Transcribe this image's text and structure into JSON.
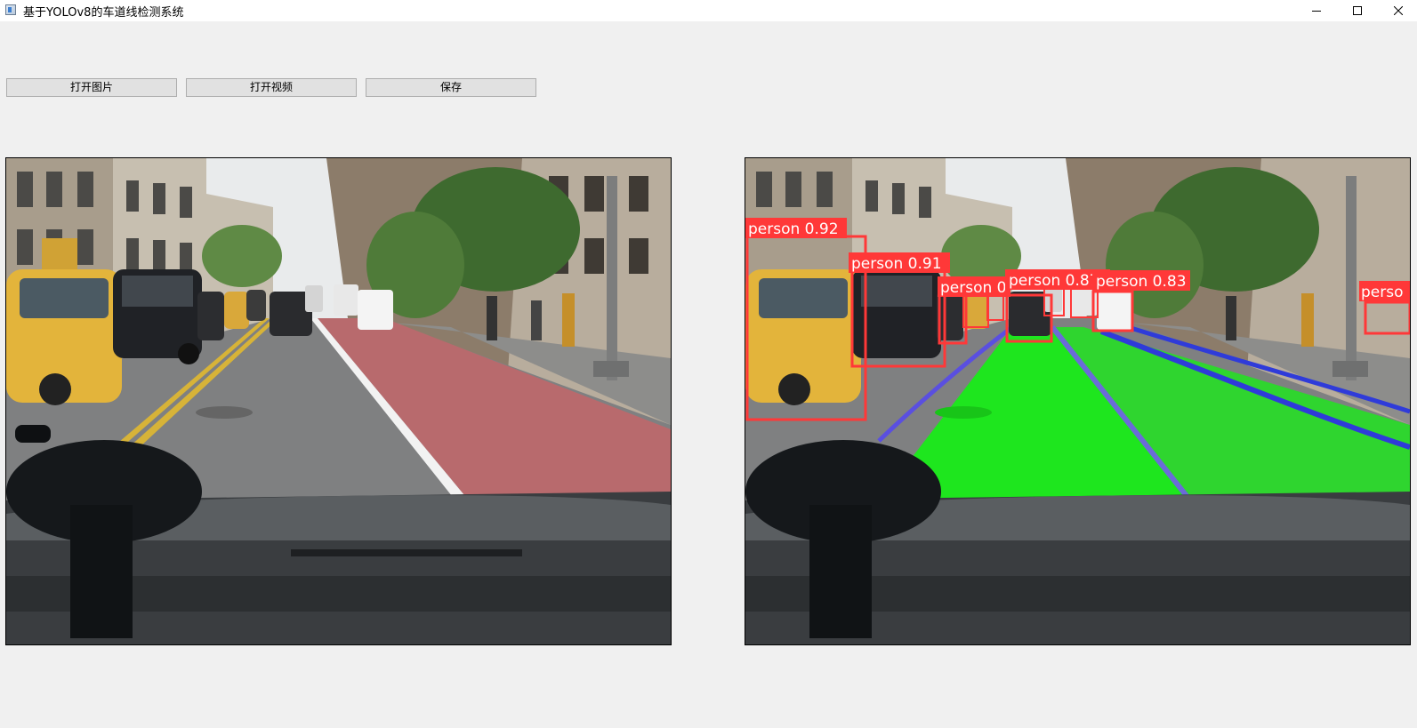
{
  "window": {
    "title": "基于YOLOv8的车道线检测系统",
    "icon": "app-window-icon",
    "controls": [
      "minimize-icon",
      "maximize-icon",
      "close-icon"
    ]
  },
  "toolbar": {
    "open_image_label": "打开图片",
    "open_video_label": "打开视频",
    "save_label": "保存"
  },
  "detections": [
    {
      "label": "person 0.92"
    },
    {
      "label": "person 0.91"
    },
    {
      "label": "person 0"
    },
    {
      "label": "person 0.87"
    },
    {
      "label": "person 0.83"
    },
    {
      "label": "perso"
    }
  ],
  "colors": {
    "window_bg": "#f0f0f0",
    "box": "#ff3838",
    "lane_fill": "#1ee61e",
    "lane_line": "#5a4fe0"
  }
}
